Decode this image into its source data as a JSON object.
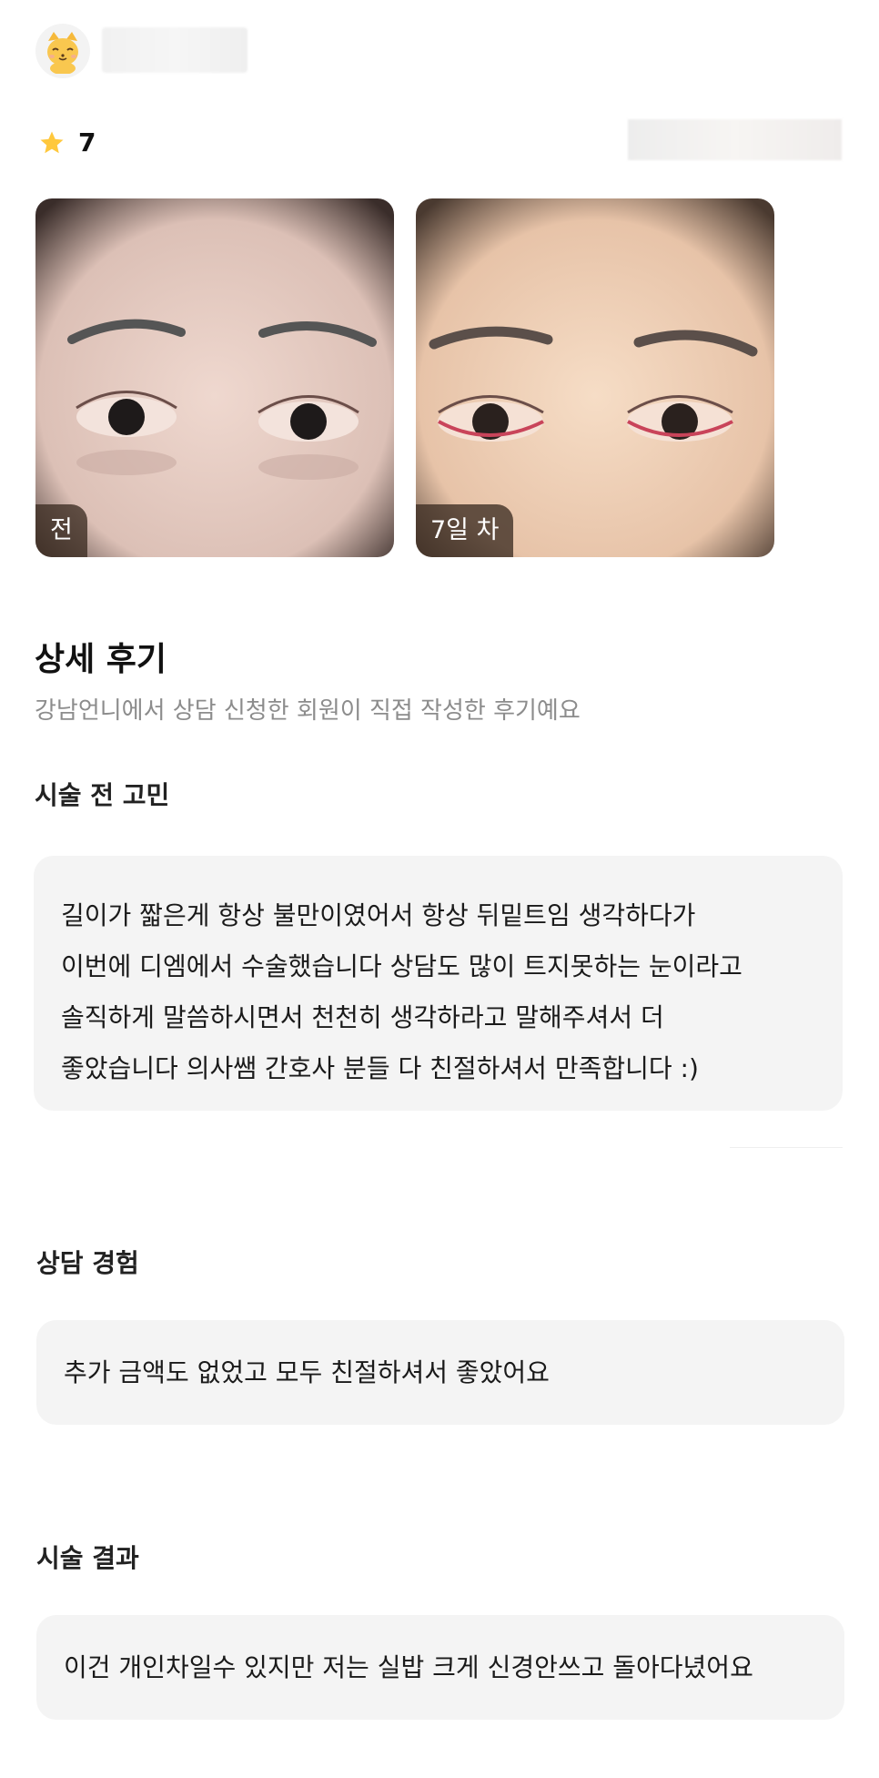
{
  "reviewer": {
    "avatar_icon": "cat-icon",
    "name": ""
  },
  "rating": {
    "icon": "star-icon",
    "value": "7",
    "color": "#FFC83D"
  },
  "photos": [
    {
      "label": "전"
    },
    {
      "label": "7일 차"
    }
  ],
  "detail": {
    "title": "상세 후기",
    "subtitle": "강남언니에서 상담 신청한 회원이 직접 작성한 후기예요"
  },
  "sections": [
    {
      "heading": "시술 전 고민",
      "lines": [
        "길이가 짧은게 항상 불만이였어서 항상 뒤밑트임 생각하다가",
        "이번에 디엠에서 수술했습니다 상담도 많이 트지못하는 눈이라고",
        "솔직하게 말씀하시면서 천천히 생각하라고 말해주셔서 더",
        "좋았습니다 의사쌤 간호사 분들 다 친절하셔서 만족합니다 :)"
      ]
    },
    {
      "heading": "상담 경험",
      "text": "추가 금액도 없었고 모두 친절하셔서 좋았어요"
    },
    {
      "heading": "시술 결과",
      "text": "이건 개인차일수 있지만 저는 실밥 크게 신경안쓰고 돌아다녔어요"
    }
  ]
}
